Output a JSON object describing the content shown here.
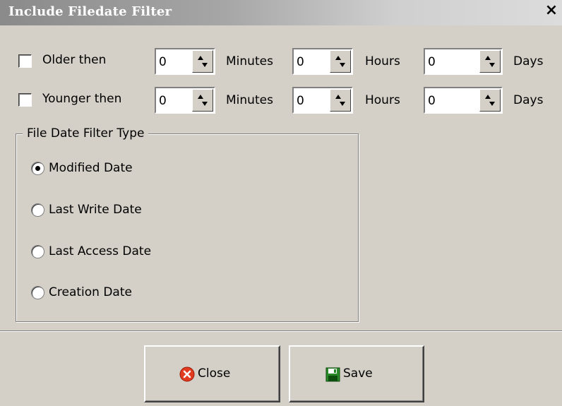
{
  "window": {
    "title": "Include Filedate Filter",
    "close_glyph": "×"
  },
  "older": {
    "label": "Older then",
    "checked": false,
    "minutes": {
      "value": "0",
      "unit": "Minutes"
    },
    "hours": {
      "value": "0",
      "unit": "Hours"
    },
    "days": {
      "value": "0",
      "unit": "Days"
    }
  },
  "younger": {
    "label": "Younger then",
    "checked": false,
    "minutes": {
      "value": "0",
      "unit": "Minutes"
    },
    "hours": {
      "value": "0",
      "unit": "Hours"
    },
    "days": {
      "value": "0",
      "unit": "Days"
    }
  },
  "filter_type": {
    "group_label": "File Date Filter Type",
    "options": [
      {
        "label": "Modified Date",
        "selected": true
      },
      {
        "label": "Last Write Date",
        "selected": false
      },
      {
        "label": "Last Access Date",
        "selected": false
      },
      {
        "label": "Creation Date",
        "selected": false
      }
    ]
  },
  "buttons": {
    "close_label": "Close",
    "save_label": "Save",
    "close_icon_color": "#e23a1e",
    "save_icon_color": "#2a8a2a"
  }
}
